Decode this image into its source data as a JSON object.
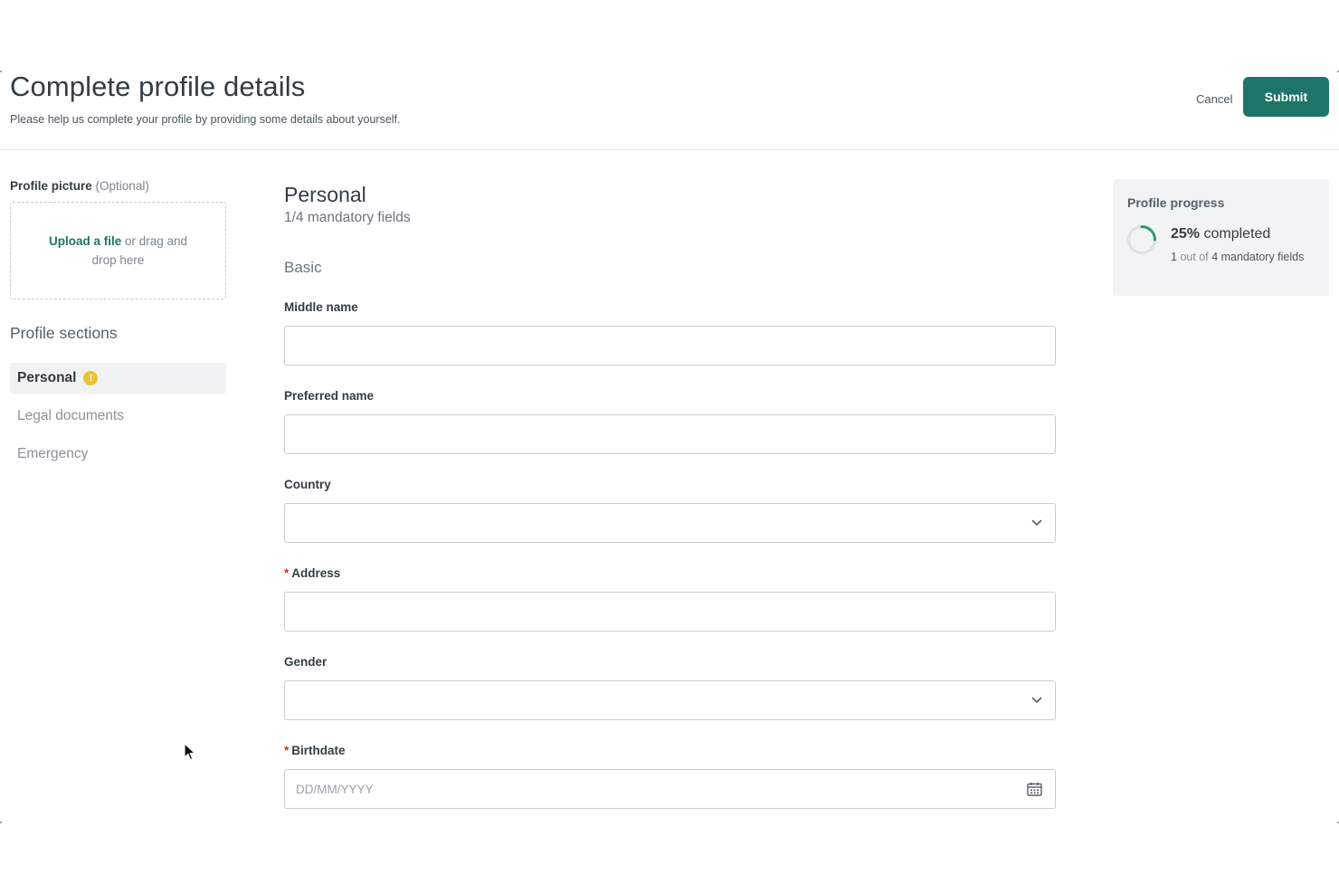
{
  "header": {
    "title": "Complete profile details",
    "subtitle": "Please help us complete your profile by providing some details about yourself.",
    "cancel_label": "Cancel",
    "submit_label": "Submit"
  },
  "profile_picture": {
    "label": "Profile picture",
    "optional": "(Optional)",
    "upload_link": "Upload a file",
    "upload_rest": "or drag and drop here"
  },
  "sections": {
    "title": "Profile sections",
    "items": [
      {
        "label": "Personal",
        "active": true,
        "warning": true
      },
      {
        "label": "Legal documents",
        "active": false,
        "warning": false
      },
      {
        "label": "Emergency",
        "active": false,
        "warning": false
      }
    ]
  },
  "form": {
    "section_title": "Personal",
    "section_sub": "1/4 mandatory fields",
    "group_title": "Basic",
    "fields": {
      "middle_name": {
        "label": "Middle name",
        "value": ""
      },
      "preferred_name": {
        "label": "Preferred name",
        "value": ""
      },
      "country": {
        "label": "Country",
        "value": ""
      },
      "address": {
        "label": "Address",
        "value": "",
        "required": true
      },
      "gender": {
        "label": "Gender",
        "value": ""
      },
      "birthdate": {
        "label": "Birthdate",
        "value": "",
        "placeholder": "DD/MM/YYYY",
        "required": true
      }
    },
    "required_marker": "*"
  },
  "progress": {
    "title": "Profile progress",
    "percent_text": "25%",
    "percent_suffix": "completed",
    "percent_value": 25,
    "done": "1",
    "out_of": "out of",
    "total": "4",
    "tail": "mandatory fields"
  },
  "colors": {
    "accent": "#1e7567",
    "warning": "#f2c12e",
    "required": "#c0392b",
    "progress_ring": "#2e9a6e"
  },
  "icons": {
    "warning": "exclamation-circle-icon",
    "dropdown": "chevron-down-icon",
    "calendar": "calendar-icon",
    "cursor": "mouse-pointer-icon"
  }
}
